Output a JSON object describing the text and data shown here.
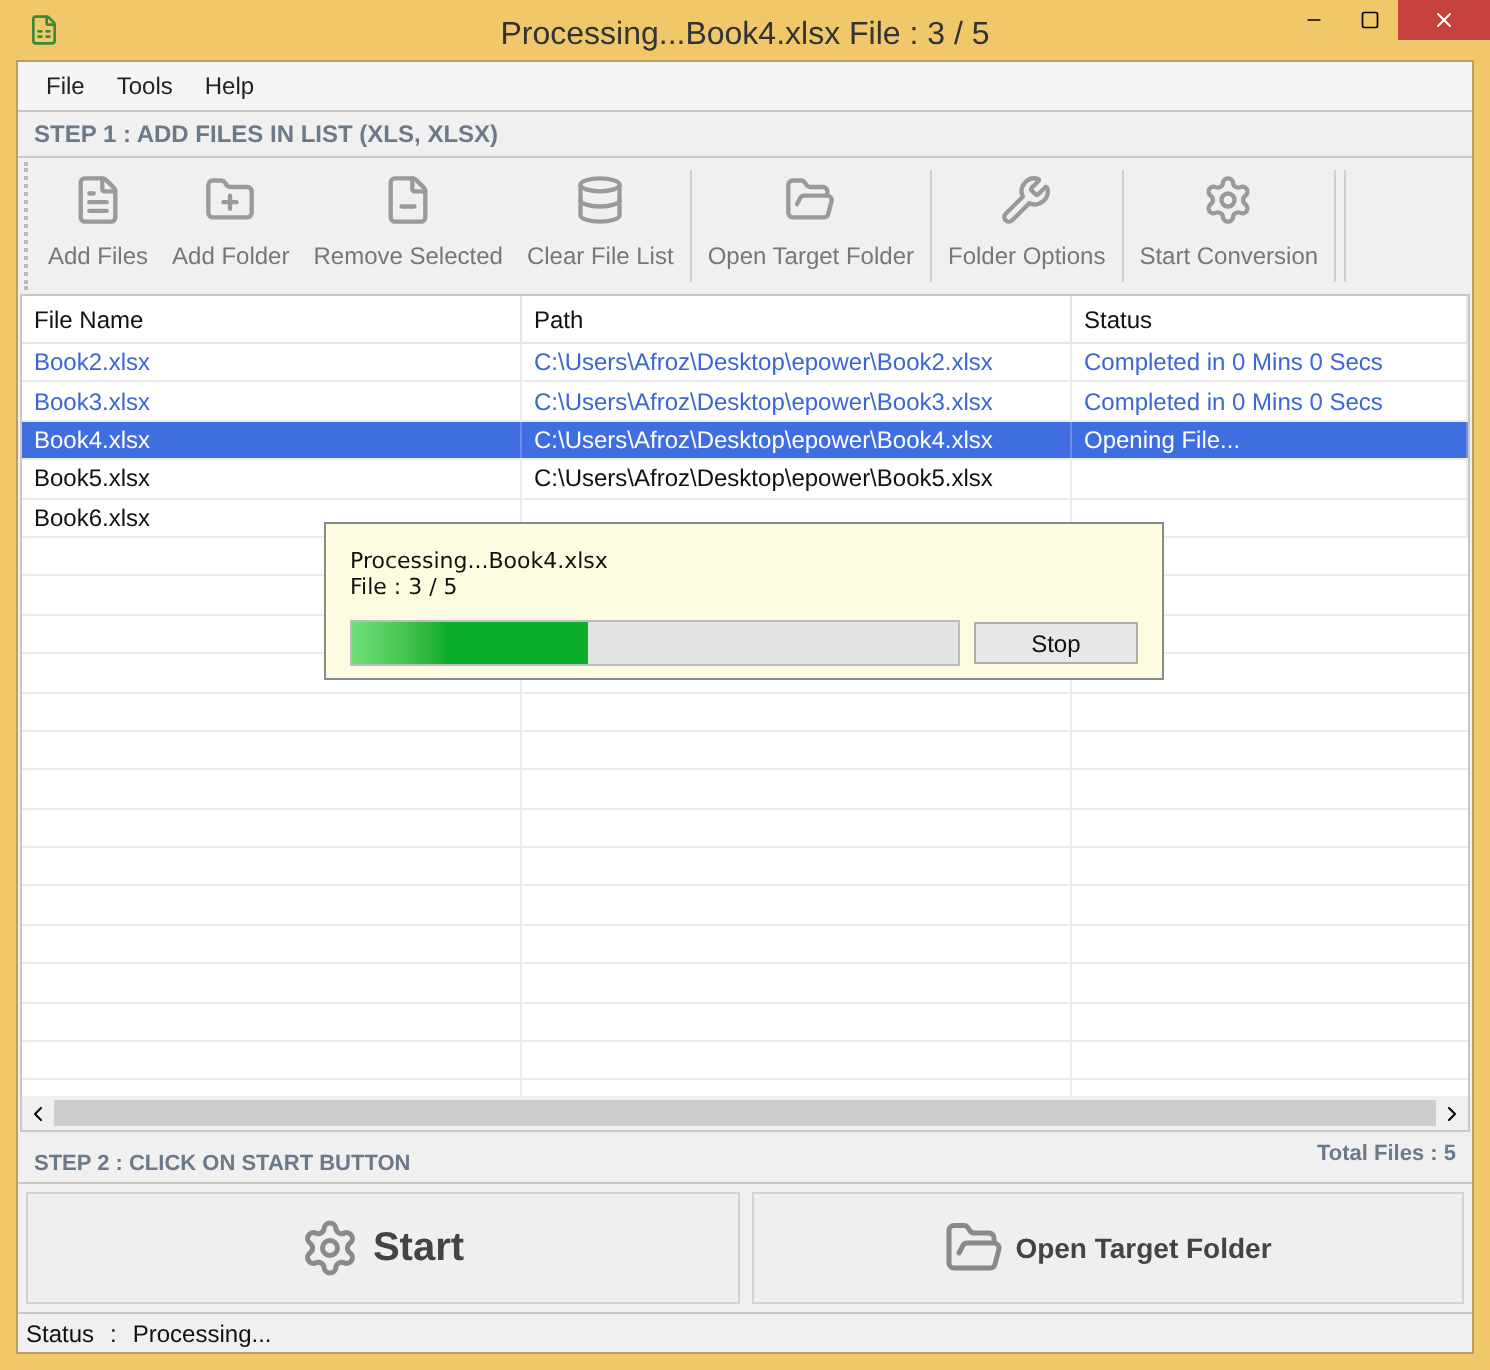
{
  "window": {
    "title": "Processing...Book4.xlsx File : 3 / 5"
  },
  "menu": [
    "File",
    "Tools",
    "Help"
  ],
  "step1": "STEP 1 : ADD FILES IN LIST (XLS, XLSX)",
  "toolbar": [
    {
      "kind": "add-files",
      "label": "Add Files",
      "disabled": true
    },
    {
      "kind": "add-folder",
      "label": "Add Folder",
      "disabled": true
    },
    {
      "kind": "remove",
      "label": "Remove Selected",
      "disabled": true
    },
    {
      "kind": "clear",
      "label": "Clear File List",
      "disabled": true
    },
    {
      "kind": "open",
      "label": "Open Target Folder",
      "disabled": true
    },
    {
      "kind": "options",
      "label": "Folder Options",
      "disabled": true
    },
    {
      "kind": "start",
      "label": "Start Conversion",
      "disabled": true
    }
  ],
  "table": {
    "columns": [
      "File Name",
      "Path",
      "Status"
    ],
    "rows": [
      {
        "cells": [
          "Book2.xlsx",
          "C:\\Users\\Afroz\\Desktop\\epower\\Book2.xlsx",
          "Completed in 0 Mins 0 Secs"
        ],
        "completed": true,
        "selected": false
      },
      {
        "cells": [
          "Book3.xlsx",
          "C:\\Users\\Afroz\\Desktop\\epower\\Book3.xlsx",
          "Completed in 0 Mins 0 Secs"
        ],
        "completed": true,
        "selected": false
      },
      {
        "cells": [
          "Book4.xlsx",
          "C:\\Users\\Afroz\\Desktop\\epower\\Book4.xlsx",
          "Opening File..."
        ],
        "completed": false,
        "selected": true
      },
      {
        "cells": [
          "Book5.xlsx",
          "C:\\Users\\Afroz\\Desktop\\epower\\Book5.xlsx"
        ],
        "completed": false,
        "selected": false
      },
      {
        "cells": [
          "Book6.xlsx"
        ],
        "completed": false,
        "selected": false
      }
    ]
  },
  "dialog": {
    "line1": "Processing...Book4.xlsx",
    "line2": "File : 3 / 5",
    "level": 0.39,
    "button": "Stop"
  },
  "step2": "STEP 2 : CLICK ON START BUTTON",
  "total_files": "Total Files : 5",
  "actions": [
    {
      "kind": "start",
      "label": "Start"
    },
    {
      "kind": "open",
      "label": "Open Target Folder"
    }
  ],
  "status_bar": {
    "label": "Status",
    "separator": ":",
    "value": "Processing..."
  }
}
